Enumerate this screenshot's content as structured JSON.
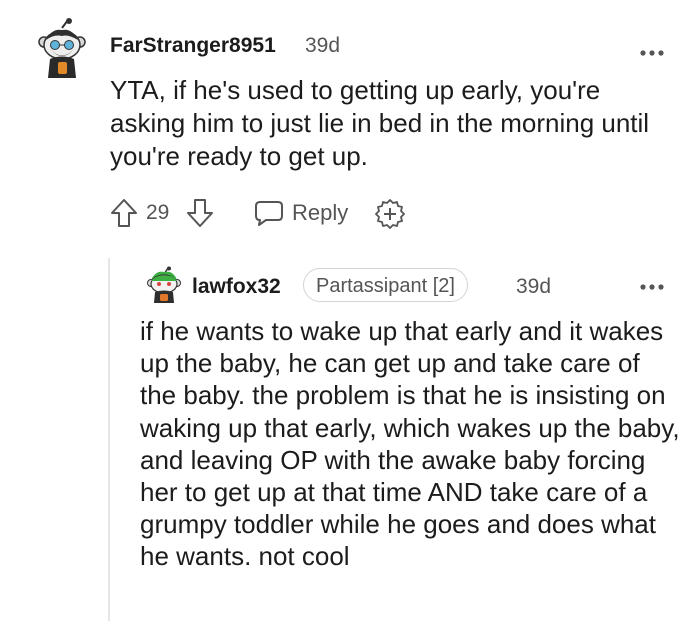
{
  "comment": {
    "author": "FarStranger8951",
    "time": "39d",
    "body": "YTA, if he's used to getting up early, you're asking him to just lie in bed in the morning until you're ready to get up.",
    "votes": "29",
    "reply_label": "Reply"
  },
  "reply": {
    "author": "lawfox32",
    "flair": "Partassipant [2]",
    "time": "39d",
    "body": "if he wants to wake up that early and it wakes up the baby, he can get up and take care of the baby. the problem is that he is insisting on waking up that early, which wakes up the baby, and leaving OP with the awake baby forcing her to get up at that time AND take care of a grumpy toddler while he goes and does what he wants. not cool"
  },
  "icons": {
    "avatar1": "reddit-snoo-avatar-icon",
    "avatar2": "reddit-snoo-avatar-icon",
    "more": "more-options-icon",
    "upvote": "upvote-arrow-icon",
    "downvote": "downvote-arrow-icon",
    "reply": "speech-bubble-icon",
    "award": "award-icon"
  },
  "colors": {
    "text": "#1c1c1c",
    "meta": "#555555",
    "thread_line": "#e6e6e6"
  }
}
